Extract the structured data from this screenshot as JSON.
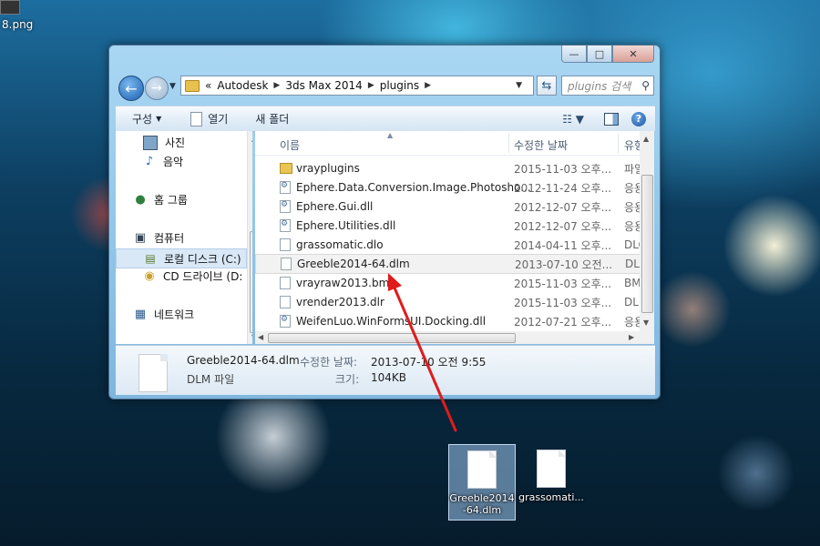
{
  "desktop": {
    "top_file_label": "8.png",
    "icons": [
      {
        "label_line1": "Greeble2014",
        "label_line2": "-64.dlm",
        "selected": true
      },
      {
        "label_line1": "grassomati...",
        "label_line2": "",
        "selected": false
      }
    ]
  },
  "window": {
    "caption": {
      "minimize": "—",
      "maximize": "□",
      "close": "✕"
    },
    "address": {
      "overflow": "«",
      "segments": [
        "Autodesk",
        "3ds Max 2014",
        "plugins"
      ]
    },
    "search": {
      "placeholder": "plugins 검색"
    },
    "toolbar": {
      "organize": "구성",
      "open": "열기",
      "new_folder": "새 폴더"
    },
    "nav": {
      "items": [
        "사진",
        "음악",
        "홈 그룹",
        "컴퓨터",
        "로컬 디스크 (C:)",
        "CD 드라이브 (D:",
        "네트워크"
      ]
    },
    "columns": {
      "name": "이름",
      "date": "수정한 날짜",
      "type": "유형"
    },
    "files": [
      {
        "name": "vrayplugins",
        "date": "2015-11-03 오후...",
        "type": "파일",
        "icon": "folder-icon"
      },
      {
        "name": "Ephere.Data.Conversion.Image.Photosho...",
        "date": "2012-11-24 오후...",
        "type": "응용",
        "icon": "dll-icon"
      },
      {
        "name": "Ephere.Gui.dll",
        "date": "2012-12-07 오후...",
        "type": "응용",
        "icon": "dll-icon"
      },
      {
        "name": "Ephere.Utilities.dll",
        "date": "2012-12-07 오후...",
        "type": "응용",
        "icon": "dll-icon"
      },
      {
        "name": "grassomatic.dlo",
        "date": "2014-04-11 오후...",
        "type": "DLO",
        "icon": "file-icon"
      },
      {
        "name": "Greeble2014-64.dlm",
        "date": "2013-07-10 오전...",
        "type": "DLM",
        "icon": "file-icon"
      },
      {
        "name": "vrayraw2013.bmi",
        "date": "2015-11-03 오후...",
        "type": "BMI",
        "icon": "file-icon"
      },
      {
        "name": "vrender2013.dlr",
        "date": "2015-11-03 오후...",
        "type": "DLR",
        "icon": "file-icon"
      },
      {
        "name": "WeifenLuo.WinFormsUI.Docking.dll",
        "date": "2012-07-21 오후...",
        "type": "응용",
        "icon": "dll-icon"
      }
    ],
    "details": {
      "name": "Greeble2014-64.dlm",
      "type": "DLM 파일",
      "modified_label": "수정한 날짜:",
      "modified_value": "2013-07-10 오전 9:55",
      "size_label": "크기:",
      "size_value": "104KB"
    }
  },
  "colors": {
    "arrow": "#e01b1b",
    "selection": "#d9e8f7"
  }
}
